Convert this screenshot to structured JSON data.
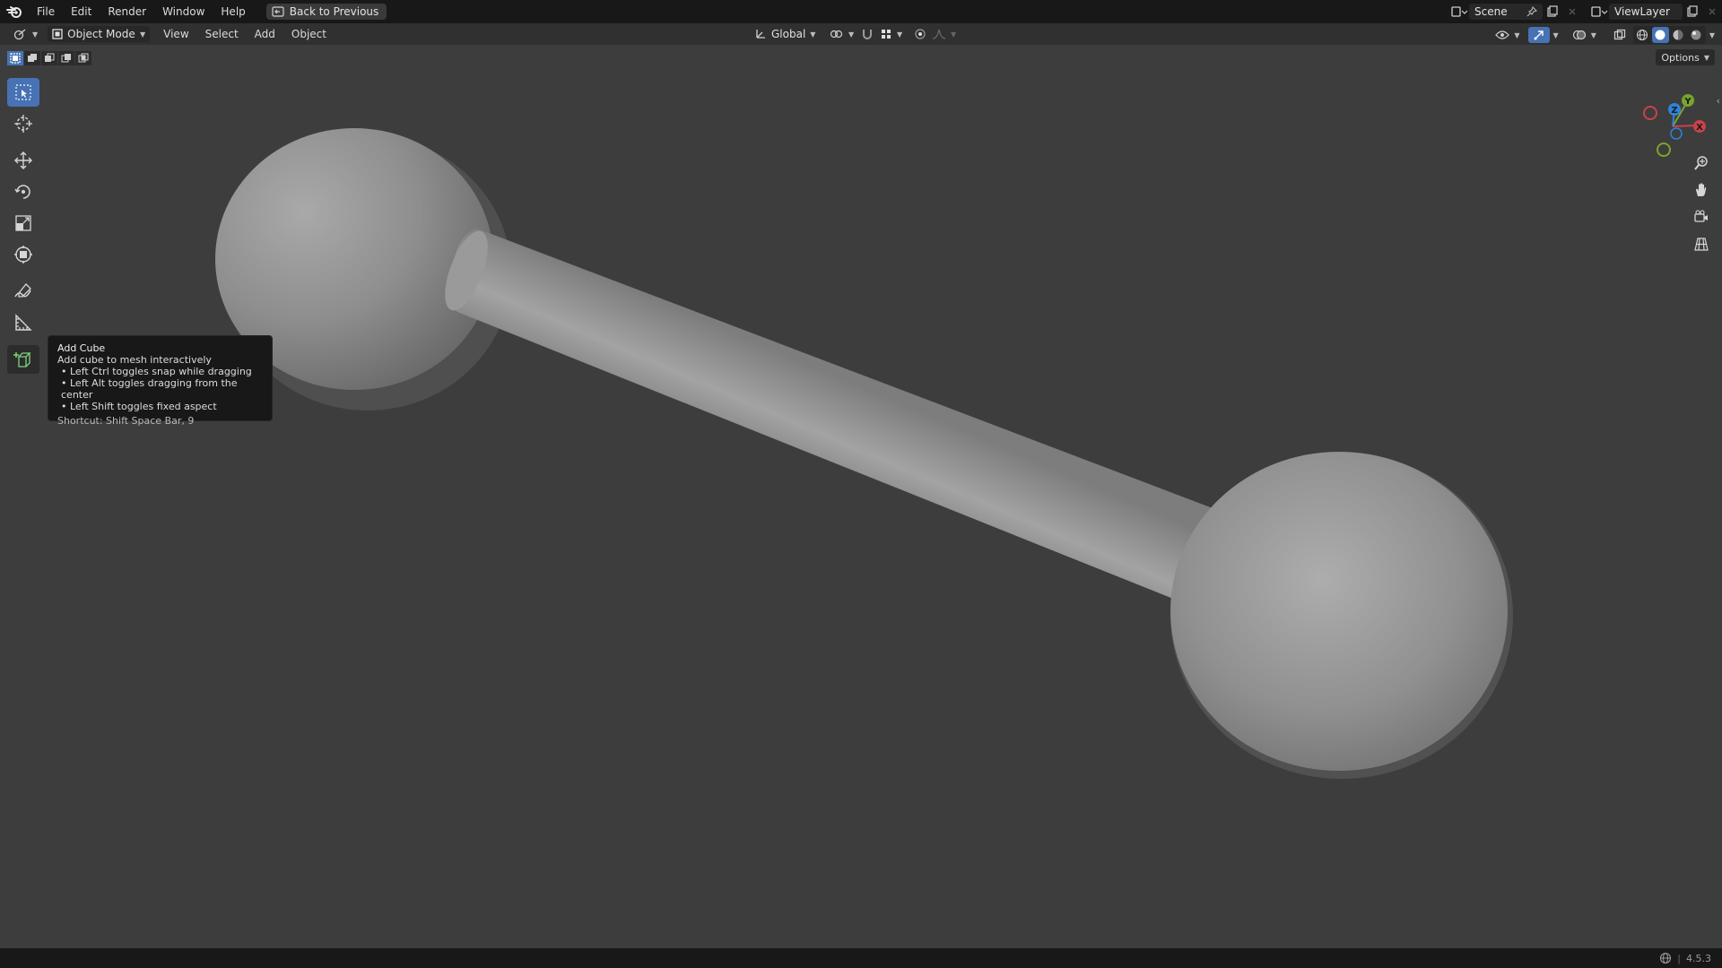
{
  "topbar": {
    "menus": [
      "File",
      "Edit",
      "Render",
      "Window",
      "Help"
    ],
    "back_button": "Back to Previous",
    "scene": "Scene",
    "view_layer": "ViewLayer"
  },
  "header": {
    "mode": "Object Mode",
    "menus": [
      "View",
      "Select",
      "Add",
      "Object"
    ],
    "transform_orientation": "Global"
  },
  "viewport": {
    "options_label": "Options",
    "gizmo": {
      "x": "X",
      "y": "Y",
      "z": "Z"
    }
  },
  "tooltip": {
    "title": "Add Cube",
    "description": "Add cube to mesh interactively",
    "bullets": [
      "• Left Ctrl toggles snap while dragging",
      "• Left Alt toggles dragging from the center",
      "• Left Shift toggles fixed aspect"
    ],
    "shortcut": "Shortcut: Shift Space Bar, 9"
  },
  "statusbar": {
    "version": "4.5.3"
  },
  "colors": {
    "accent": "#4772b3",
    "axis_x": "#c9424a",
    "axis_y": "#78a52d",
    "axis_z": "#2f83d8"
  }
}
